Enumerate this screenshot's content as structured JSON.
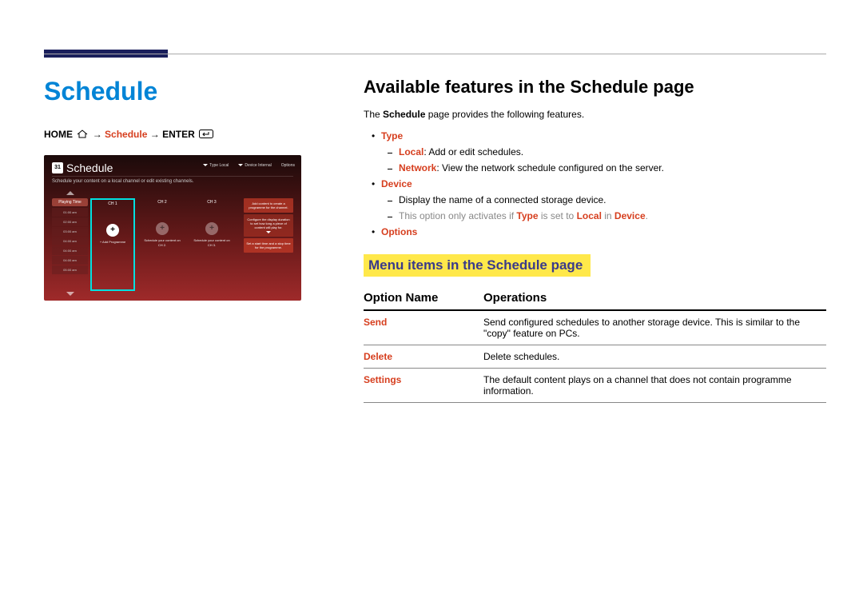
{
  "page": {
    "title": "Schedule",
    "breadcrumb": {
      "home": "HOME",
      "arrow": " → ",
      "schedule": "Schedule",
      "enter": "ENTER"
    }
  },
  "screenshot": {
    "cal_icon": "31",
    "title": "Schedule",
    "top_right": {
      "type_label": "Type",
      "type_value": "Local",
      "device_label": "Device",
      "device_value": "Internal",
      "options": "Options"
    },
    "subtitle": "Schedule your content on a local channel or edit existing channels.",
    "playing_time": "Playing Time",
    "times": [
      "01:00 am",
      "02:00 am",
      "03:00 am",
      "04:00 am",
      "04:00 am",
      "04:00 am",
      "05:00 am"
    ],
    "ch1": "CH 1",
    "ch2": "CH 2",
    "ch3": "CH 3",
    "add_programme": "+ Add Programme",
    "ch2_label": "Schedule your content on CH 2.",
    "ch3_label": "Schedule your content on CH 3.",
    "panel": {
      "a": "Add content to create a programme for the channel.",
      "b": "Configure the display duration to set how long a piece of content will play for.",
      "c": "Set a start time and a stop time for the programme."
    }
  },
  "right": {
    "h2": "Available features in the Schedule page",
    "intro_prefix": "The ",
    "intro_bold": "Schedule",
    "intro_suffix": " page provides the following features.",
    "features": {
      "type": "Type",
      "local_b": "Local",
      "local_t": ": Add or edit schedules.",
      "network_b": "Network",
      "network_t": ": View the network schedule configured on the server.",
      "device": "Device",
      "device_line": "Display the name of a connected storage device.",
      "device_note_a": "This option only activates if ",
      "device_note_b": "Type",
      "device_note_c": " is set to ",
      "device_note_d": "Local",
      "device_note_e": " in ",
      "device_note_f": "Device",
      "device_note_g": ".",
      "options": "Options"
    },
    "menu_heading": "Menu items in the Schedule page",
    "table": {
      "th1": "Option Name",
      "th2": "Operations",
      "rows": [
        {
          "name": "Send",
          "op": "Send configured schedules to another storage device. This is similar to the \"copy\" feature on PCs."
        },
        {
          "name": "Delete",
          "op": "Delete schedules."
        },
        {
          "name": "Settings",
          "op": "The default content plays on a channel that does not contain programme information."
        }
      ]
    }
  }
}
